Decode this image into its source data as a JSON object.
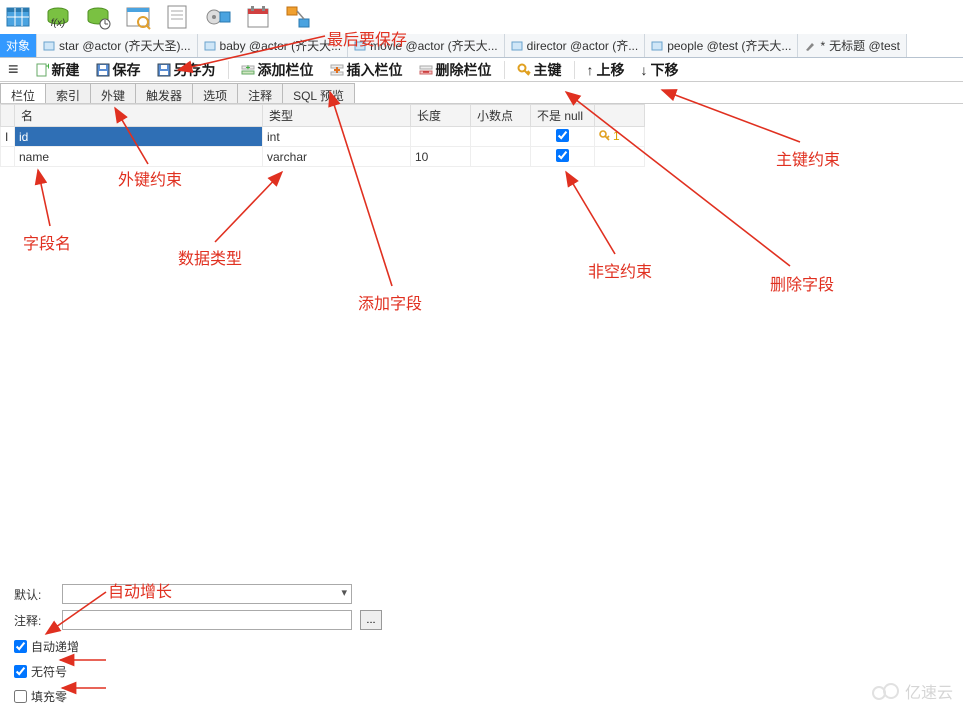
{
  "tabs": {
    "t0": "对象",
    "t1": "star @actor (齐天大圣)...",
    "t2": "baby @actor (齐天大...",
    "t3": "movie @actor (齐天大...",
    "t4": "director @actor (齐...",
    "t5": "people @test (齐天大...",
    "t6": "无标题 @test"
  },
  "actions": {
    "new": "新建",
    "save": "保存",
    "saveas": "另存为",
    "addcol": "添加栏位",
    "inscol": "插入栏位",
    "delcol": "删除栏位",
    "pk": "主键",
    "up": "上移",
    "down": "下移"
  },
  "subtabs": {
    "t0": "栏位",
    "t1": "索引",
    "t2": "外键",
    "t3": "触发器",
    "t4": "选项",
    "t5": "注释",
    "t6": "SQL 预览"
  },
  "gridhead": {
    "name": "名",
    "type": "类型",
    "len": "长度",
    "dec": "小数点",
    "nn": "不是 null",
    "key": ""
  },
  "rows": [
    {
      "name": "id",
      "type": "int",
      "len": "",
      "dec": "",
      "nn": true,
      "key": "1"
    },
    {
      "name": "name",
      "type": "varchar",
      "len": "10",
      "dec": "",
      "nn": true,
      "key": ""
    }
  ],
  "props": {
    "default": "默认:",
    "comment": "注释:",
    "ai": "自动递增",
    "unsigned": "无符号",
    "zerofill": "填充零"
  },
  "anno": {
    "a_save": "最后要保存",
    "a_fk": "外键约束",
    "a_name": "字段名",
    "a_type": "数据类型",
    "a_add": "添加字段",
    "a_nn": "非空约束",
    "a_pk": "主键约束",
    "a_del": "删除字段",
    "a_ai": "自动增长"
  },
  "wm": "亿速云"
}
